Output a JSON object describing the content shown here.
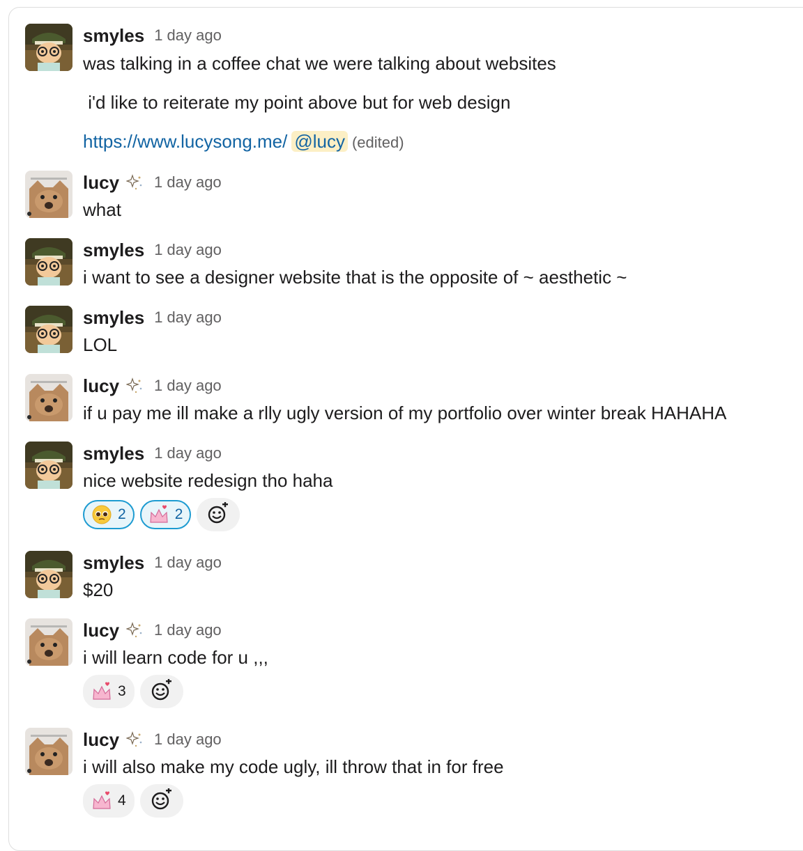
{
  "messages": [
    {
      "author": "smyles",
      "time": "1 day ago",
      "avatar_icon": "smyles-avatar-icon",
      "lines": [
        "was talking in a coffee chat we were talking about websites",
        " i'd like to reiterate my point above but for web design"
      ],
      "link": "https://www.lucysong.me/",
      "mention": "@lucy",
      "edited": "(edited)"
    },
    {
      "author": "lucy",
      "time": "1 day ago",
      "avatar_icon": "cat-avatar-icon",
      "status_icon": "sparkle-status-icon",
      "text": "what"
    },
    {
      "author": "smyles",
      "time": "1 day ago",
      "text": "i want to see a designer website that is the opposite of ~ aesthetic ~"
    },
    {
      "author": "smyles",
      "time": "1 day ago",
      "text": "LOL"
    },
    {
      "author": "lucy",
      "time": "1 day ago",
      "text": "if u pay me ill make a rlly ugly version of my portfolio over winter break HAHAHA"
    },
    {
      "author": "smyles",
      "time": "1 day ago",
      "text": "nice website redesign tho haha",
      "reactions": [
        {
          "emoji": "pleading-face-emoji",
          "count": "2",
          "active": true
        },
        {
          "emoji": "pink-crown-emoji",
          "count": "2",
          "active": true
        }
      ]
    },
    {
      "author": "smyles",
      "time": "1 day ago",
      "text": "$20"
    },
    {
      "author": "lucy",
      "time": "1 day ago",
      "text": "i will learn code for u ,,,",
      "reactions": [
        {
          "emoji": "pink-crown-emoji",
          "count": "3",
          "active": false
        }
      ]
    },
    {
      "author": "lucy",
      "time": "1 day ago",
      "text": "i will also make my code ugly, ill throw that in for free",
      "reactions": [
        {
          "emoji": "pink-crown-emoji",
          "count": "4",
          "active": false
        }
      ]
    }
  ],
  "colors": {
    "link": "#1264a3",
    "mention_bg": "#fcefc5",
    "reaction_active_border": "#1d9bd1",
    "reaction_active_bg": "#e8f5fa"
  }
}
